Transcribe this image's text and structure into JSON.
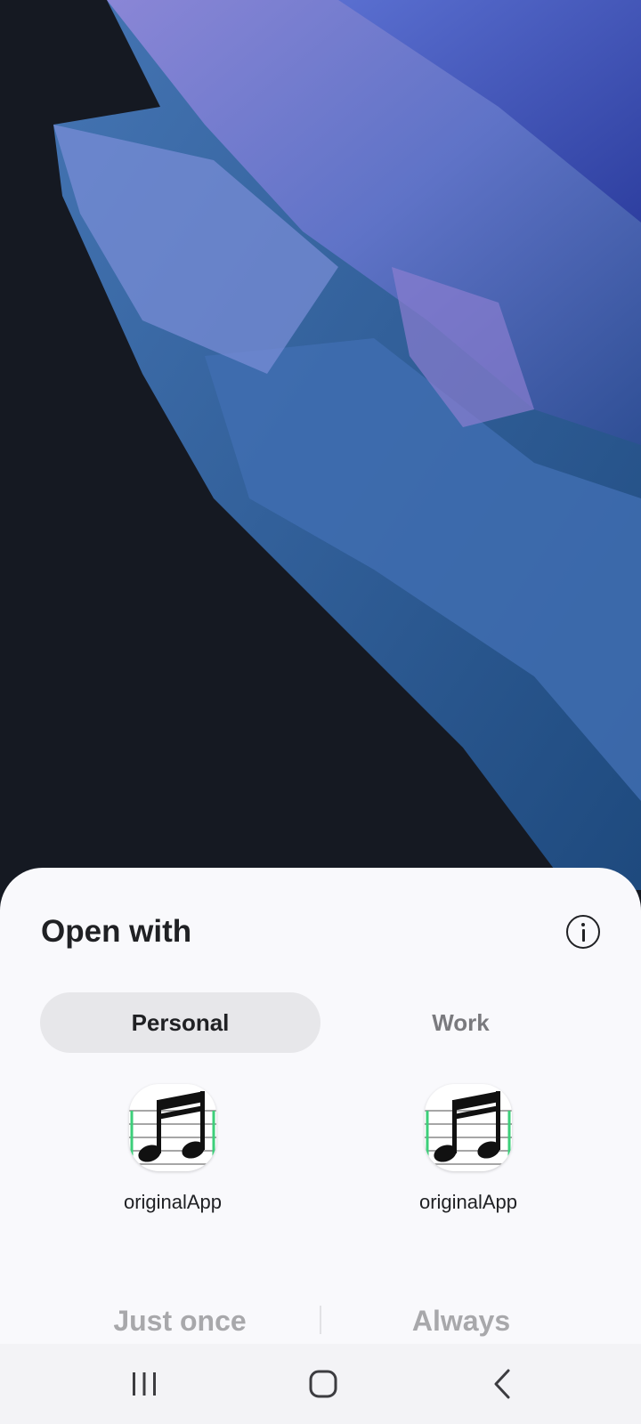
{
  "dialog": {
    "title": "Open with",
    "info_icon": "info-icon"
  },
  "tabs": [
    {
      "label": "Personal",
      "selected": true
    },
    {
      "label": "Work",
      "selected": false
    }
  ],
  "apps": [
    {
      "name": "originalApp",
      "icon": "music-notes-icon"
    },
    {
      "name": "originalApp",
      "icon": "music-notes-icon"
    }
  ],
  "actions": {
    "just_once": "Just once",
    "always": "Always"
  },
  "navbar": {
    "recents_icon": "recents-icon",
    "home_icon": "home-icon",
    "back_icon": "back-icon"
  },
  "colors": {
    "sheet_background": "#f9f9fc",
    "wallpaper_background": "#151922",
    "selected_tab": "#e7e7ea",
    "disabled_action": "#a8a8ab"
  }
}
